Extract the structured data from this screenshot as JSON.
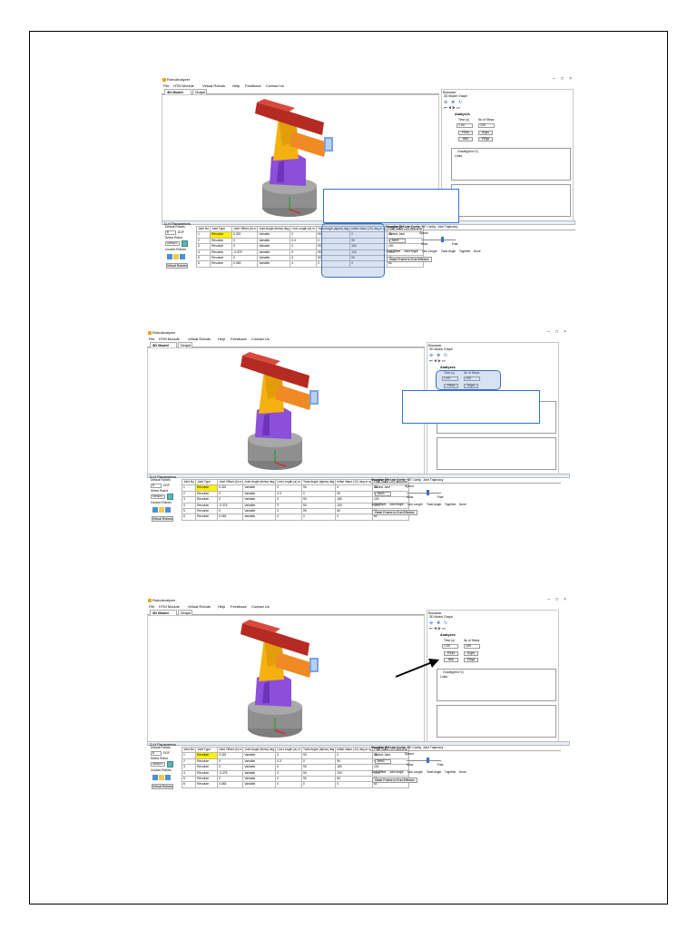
{
  "app": {
    "title": "RoboAnalyzer",
    "menu": [
      "File",
      "HTM Module",
      "Virtual Robots",
      "Help",
      "Feedback",
      "Contact Us"
    ],
    "view_tabs": [
      "3D Model",
      "Graph"
    ],
    "window_controls": [
      "–",
      "□",
      "×"
    ]
  },
  "browser": {
    "title": "Browser",
    "tabs": [
      "3D Model",
      "Graph"
    ],
    "analyses_title": "Analyses",
    "time_label": "Time (s)",
    "steps_label": "No of Steps",
    "time_value": "1.00",
    "steps_value": "100",
    "fkin_button": "FKin",
    "ikin_button": "IKin",
    "idyn_button": "IDyn",
    "fdyn_button": "FDyn",
    "gravity_label": "Gravity(m/s^2)",
    "links_label": "Links"
  },
  "dh": {
    "header": "D-H Parameters",
    "default_robots_label": "Default Robots",
    "dof_value": "6",
    "dof_label": "DOF",
    "select_robot_label": "Select Robot",
    "robot_value": "KR5ETC",
    "custom_robots_label": "Custom Robots",
    "virtual_robots_button": "Virtual Robots",
    "columns": [
      "Joint No",
      "Joint Type",
      "Joint Offset (b) m",
      "Joint Angle (theta) deg",
      "Link Length (a) m",
      "Twist Angle (alpha) deg",
      "Initial Value (JV) deg or m",
      "Final Value (JV) deg or m"
    ],
    "rows": [
      [
        "1",
        "Revolute",
        "0.322",
        "Variable",
        "0",
        "90",
        "0",
        "60"
      ],
      [
        "2",
        "Revolute",
        "0",
        "Variable",
        "0.3",
        "0",
        "90",
        "60"
      ],
      [
        "3",
        "Revolute",
        "0",
        "Variable",
        "0",
        "90",
        "160",
        "100"
      ],
      [
        "4",
        "Revolute",
        "-0.375",
        "Variable",
        "0",
        "90",
        "100",
        "-200"
      ],
      [
        "5",
        "Revolute",
        "0",
        "Variable",
        "0",
        "90",
        "60",
        "60"
      ],
      [
        "6",
        "Revolute",
        "0.063",
        "Variable",
        "0",
        "0",
        "0",
        "60"
      ]
    ]
  },
  "visualize": {
    "tabs": [
      "Visualize DH",
      "Link Config",
      "EE Config",
      "Joint Trajectory"
    ],
    "select_joint_label": "Select Joint",
    "joint_value": "Joint1",
    "speed_label": "Speed",
    "slow_label": "Slow",
    "fast_label": "Fast",
    "options": [
      "Joint Offset",
      "Joint Angle",
      "Link Length",
      "Twist Angle",
      "Together",
      "None"
    ],
    "base_frame_button": "Base Frame to End-Effector"
  },
  "colors": {
    "link_red": "#b52a22",
    "link_yellow": "#f4b10f",
    "link_orange": "#f08a24",
    "link_purple": "#8c4fd9",
    "base_gray": "#8a8a8a",
    "callout_blue": "#2f74d0",
    "highlight_yellow": "#fff200"
  }
}
